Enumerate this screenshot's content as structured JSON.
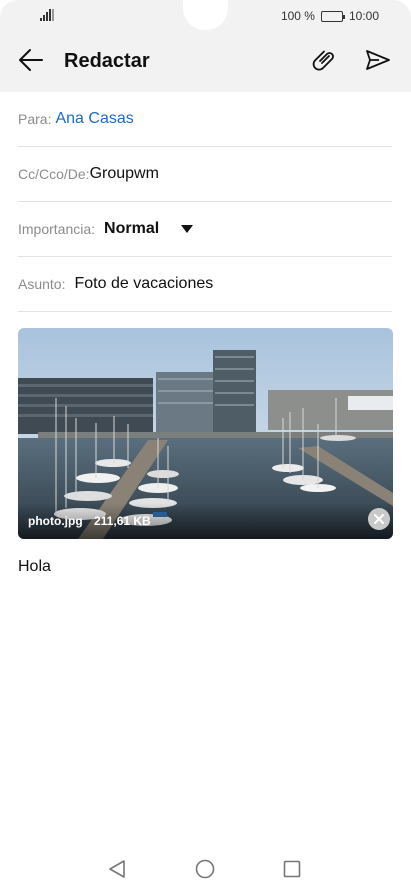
{
  "status_bar": {
    "battery_text": "100 %",
    "time": "10:00"
  },
  "app_bar": {
    "title": "Redactar"
  },
  "fields": {
    "to_label": "Para:",
    "to_value": "Ana Casas",
    "cc_label": "Cc/Cco/De:",
    "cc_value": "Groupwm",
    "importance_label": "Importancia:",
    "importance_value": "Normal",
    "subject_label": "Asunto:",
    "subject_value": "Foto de vacaciones"
  },
  "attachment": {
    "file_name": "photo.jpg",
    "file_size": "211,61 KB"
  },
  "body": {
    "text": "Hola"
  },
  "icons": {
    "back": "arrow-left-icon",
    "attach": "paperclip-icon",
    "send": "send-icon",
    "dropdown": "triangle-down-icon",
    "remove": "close-circle-icon",
    "nav_back": "triangle-back-icon",
    "nav_home": "circle-home-icon",
    "nav_recent": "square-recent-icon"
  },
  "colors": {
    "accent": "#1a6bc8",
    "header_bg": "#f2f2f2"
  }
}
